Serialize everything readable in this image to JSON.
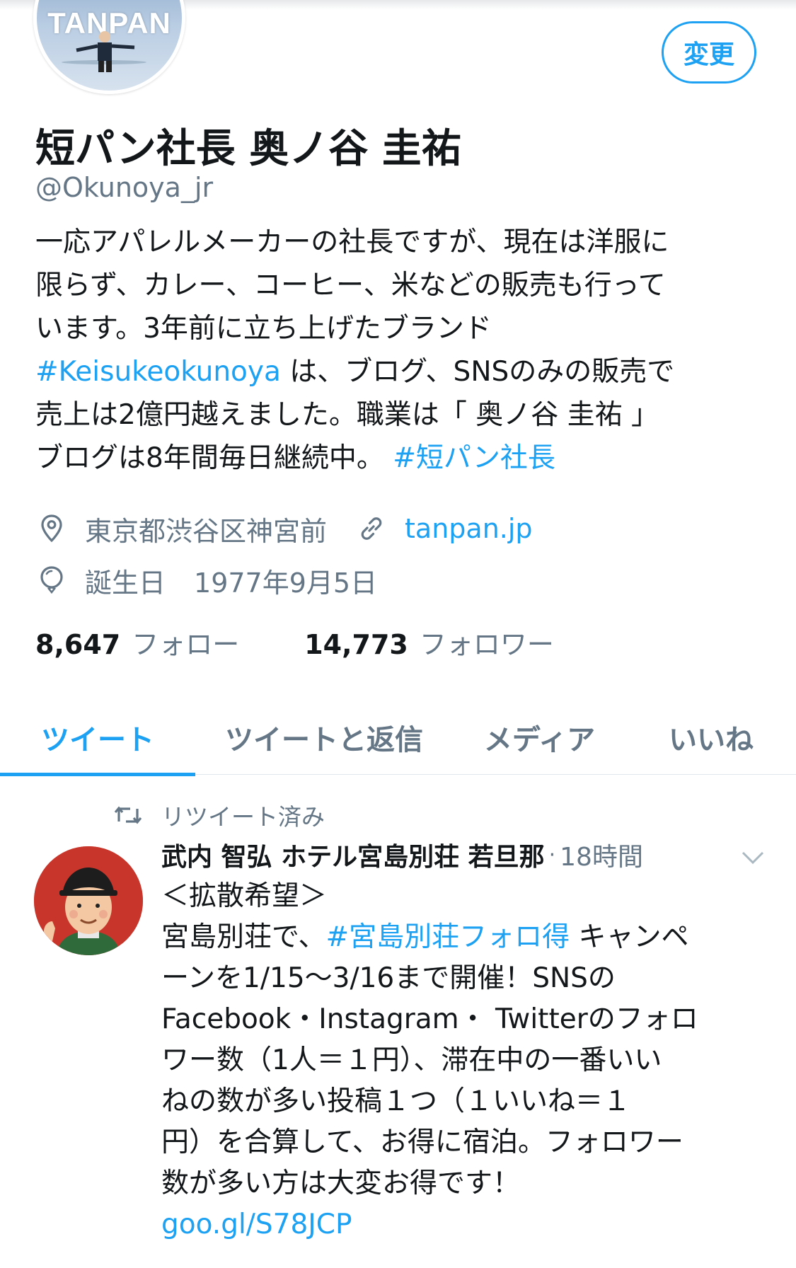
{
  "profile": {
    "avatar_logo_text": "TANPAN",
    "edit_button_label": "変更",
    "display_name": "短パン社長 奥ノ谷 圭祐",
    "handle": "@Okunoya_jr",
    "bio_lines": [
      {
        "text": "一応アパレルメーカーの社長ですが、現在は洋服に"
      },
      {
        "text": "限らず、カレー、コーヒー、米などの販売も行って"
      },
      {
        "text": "います。3年前に立ち上げたブランド"
      },
      {
        "link": "#Keisukeokunoya",
        "text": " は、ブログ、SNSのみの販売で"
      },
      {
        "text": "売上は2億円越えました。職業は「 奥ノ谷 圭祐 」"
      },
      {
        "text": "ブログは8年間毎日継続中。 ",
        "link": "#短パン社長"
      }
    ],
    "location": "東京都渋谷区神宮前",
    "website": "tanpan.jp",
    "birthday_label": "誕生日",
    "birthday_value": "1977年9月5日",
    "following_count": "8,647",
    "following_label": "フォロー",
    "followers_count": "14,773",
    "followers_label": "フォロワー"
  },
  "tabs": [
    {
      "label": "ツイート",
      "active": true
    },
    {
      "label": "ツイートと返信",
      "active": false
    },
    {
      "label": "メディア",
      "active": false
    },
    {
      "label": "いいね",
      "active": false
    }
  ],
  "tweet": {
    "retweet_label": "リツイート済み",
    "author_name": "武内 智弘 ホテル宮島別荘 若旦那",
    "separator": "·",
    "time": "18時間",
    "body_lines": [
      {
        "text": "＜拡散希望＞"
      },
      {
        "text": "宮島別荘で、",
        "link": "#宮島別荘フォロ得",
        "after": " キャンペ"
      },
      {
        "text": "ーンを1/15〜3/16まで開催！SNSの"
      },
      {
        "text": "Facebook・Instagram・ Twitterのフォロ"
      },
      {
        "text": "ワー数（1人＝１円）、滞在中の一番いい"
      },
      {
        "text": "ねの数が多い投稿１つ（１いいね＝１"
      },
      {
        "text": "円）を合算して、お得に宿泊。フォロワー"
      },
      {
        "text": "数が多い方は大変お得です！"
      },
      {
        "link": "goo.gl/S78JCP"
      }
    ]
  },
  "colors": {
    "accent": "#1da1f2",
    "secondary_text": "#657786",
    "primary_text": "#14171a"
  },
  "icons": {
    "location": "location-pin-icon",
    "website": "link-icon",
    "birthday": "balloon-icon",
    "retweet": "retweet-icon",
    "chevron": "chevron-down-icon"
  }
}
